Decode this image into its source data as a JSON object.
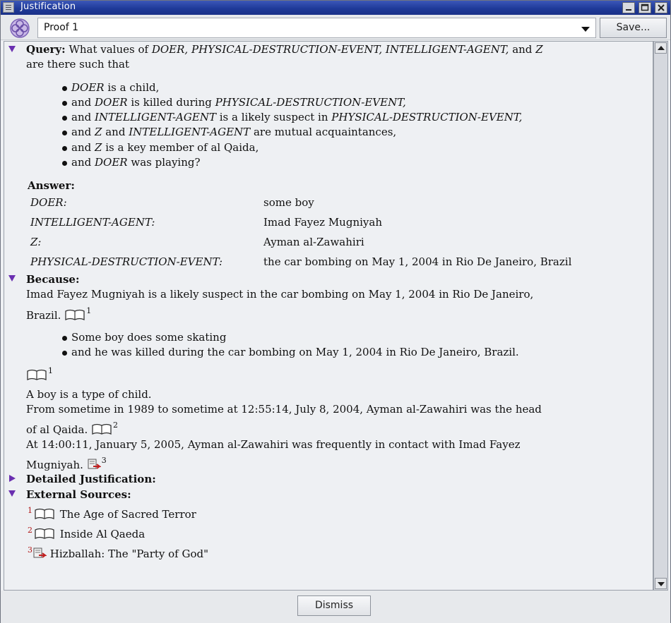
{
  "window": {
    "title": "Justification"
  },
  "toolbar": {
    "proof_selected": "Proof 1",
    "save_label": "Save..."
  },
  "query": {
    "label": "Query:",
    "line1_pre": "What values of",
    "var1": "DOER,",
    "var2": "PHYSICAL-DESTRUCTION-EVENT,",
    "var3": "INTELLIGENT-AGENT,",
    "and": "and",
    "var4": "Z",
    "line2": "are there such that",
    "b1_var": "DOER",
    "b1_rest": "is a child,",
    "b2_and": "and",
    "b2_var": "DOER",
    "b2_mid": "is killed during",
    "b2_var2": "PHYSICAL-DESTRUCTION-EVENT,",
    "b3_and": "and",
    "b3_var": "INTELLIGENT-AGENT",
    "b3_mid": "is a likely suspect in",
    "b3_var2": "PHYSICAL-DESTRUCTION-EVENT,",
    "b4_and": "and",
    "b4_var": "Z",
    "b4_and2": "and",
    "b4_var2": "INTELLIGENT-AGENT",
    "b4_rest": "are mutual acquaintances,",
    "b5_and": "and",
    "b5_var": "Z",
    "b5_rest": "is a key member of al Qaida,",
    "b6_and": "and",
    "b6_var": "DOER",
    "b6_rest": "was playing?"
  },
  "answer": {
    "label": "Answer:",
    "rows": [
      {
        "var": "DOER:",
        "value": "some boy"
      },
      {
        "var": "INTELLIGENT-AGENT:",
        "value": "Imad Fayez Mugniyah"
      },
      {
        "var": "Z:",
        "value": "Ayman al-Zawahiri"
      },
      {
        "var": "PHYSICAL-DESTRUCTION-EVENT:",
        "value": "the car bombing on May 1, 2004 in Rio De Janeiro, Brazil"
      }
    ]
  },
  "because": {
    "label": "Because:",
    "s1_line1": "Imad Fayez Mugniyah is a likely suspect in the car bombing on May 1, 2004 in Rio De Janeiro,",
    "s1_line2": "Brazil.",
    "s1_ref": "1",
    "bullet1": "Some boy does some skating",
    "bullet2": "and he was killed during the car bombing on May 1, 2004 in Rio De Janeiro, Brazil.",
    "bullets_ref": "1",
    "s2": "A boy is a type of child.",
    "s3_line1": "From sometime in 1989 to sometime at 12:55:14, July 8, 2004, Ayman al-Zawahiri was the head",
    "s3_line2": "of al Qaida.",
    "s3_ref": "2",
    "s4_line1": "At 14:00:11, January 5, 2005, Ayman al-Zawahiri was frequently in contact with Imad Fayez",
    "s4_line2": "Mugniyah.",
    "s4_ref": "3"
  },
  "detailed": {
    "label": "Detailed Justification:"
  },
  "external": {
    "label": "External Sources:",
    "sources": [
      {
        "num": "1",
        "title": "The Age of Sacred Terror",
        "icon": "book-icon"
      },
      {
        "num": "2",
        "title": "Inside Al Qaeda",
        "icon": "book-icon"
      },
      {
        "num": "3",
        "title": "Hizballah: The \"Party of God\"",
        "icon": "document-icon"
      }
    ]
  },
  "footer": {
    "dismiss_label": "Dismiss"
  },
  "colors": {
    "title_bar": "#1f3a99",
    "triangle": "#6a2fb0",
    "footnote_red": "#b01818"
  }
}
